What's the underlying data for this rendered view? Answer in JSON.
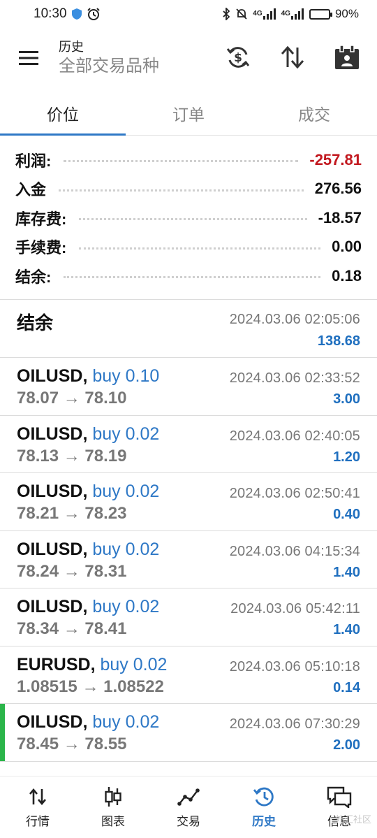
{
  "status_bar": {
    "time": "10:30",
    "battery": "90%",
    "battery_level": 0.9,
    "signal1": "4G",
    "signal2": "4G"
  },
  "header": {
    "title": "历史",
    "subtitle": "全部交易品种"
  },
  "tabs": [
    {
      "label": "价位",
      "active": true
    },
    {
      "label": "订单",
      "active": false
    },
    {
      "label": "成交",
      "active": false
    }
  ],
  "summary": [
    {
      "label": "利润:",
      "value": "-257.81"
    },
    {
      "label": "入金",
      "value": "276.56"
    },
    {
      "label": "库存费:",
      "value": "-18.57"
    },
    {
      "label": "手续费:",
      "value": "0.00"
    },
    {
      "label": "结余:",
      "value": "0.18"
    }
  ],
  "balance": {
    "title": "结余",
    "time": "2024.03.06 02:05:06",
    "amount": "138.68"
  },
  "trades": [
    {
      "symbol": "OILUSD,",
      "side": "buy 0.10",
      "open": "78.07",
      "close": "78.10",
      "time": "2024.03.06 02:33:52",
      "profit": "3.00"
    },
    {
      "symbol": "OILUSD,",
      "side": "buy 0.02",
      "open": "78.13",
      "close": "78.19",
      "time": "2024.03.06 02:40:05",
      "profit": "1.20"
    },
    {
      "symbol": "OILUSD,",
      "side": "buy 0.02",
      "open": "78.21",
      "close": "78.23",
      "time": "2024.03.06 02:50:41",
      "profit": "0.40"
    },
    {
      "symbol": "OILUSD,",
      "side": "buy 0.02",
      "open": "78.24",
      "close": "78.31",
      "time": "2024.03.06 04:15:34",
      "profit": "1.40"
    },
    {
      "symbol": "OILUSD,",
      "side": "buy 0.02",
      "open": "78.34",
      "close": "78.41",
      "time": "2024.03.06 05:42:11",
      "profit": "1.40"
    },
    {
      "symbol": "EURUSD,",
      "side": "buy 0.02",
      "open": "1.08515",
      "close": "1.08522",
      "time": "2024.03.06 05:10:18",
      "profit": "0.14"
    },
    {
      "symbol": "OILUSD,",
      "side": "buy 0.02",
      "open": "78.45",
      "close": "78.55",
      "time": "2024.03.06 07:30:29",
      "profit": "2.00"
    }
  ],
  "arrow": "→",
  "nav": [
    {
      "label": "行情",
      "icon": "quotes-icon",
      "active": false
    },
    {
      "label": "图表",
      "icon": "chart-icon",
      "active": false
    },
    {
      "label": "交易",
      "icon": "trade-icon",
      "active": false
    },
    {
      "label": "历史",
      "icon": "history-icon",
      "active": true
    },
    {
      "label": "信息",
      "icon": "messages-icon",
      "active": false
    }
  ],
  "watermark": "外汇社区",
  "colors": {
    "accent": "#2e78c6",
    "loss": "#c2181f",
    "profit": "#1f6fbf",
    "highlight": "#2bb54a"
  }
}
